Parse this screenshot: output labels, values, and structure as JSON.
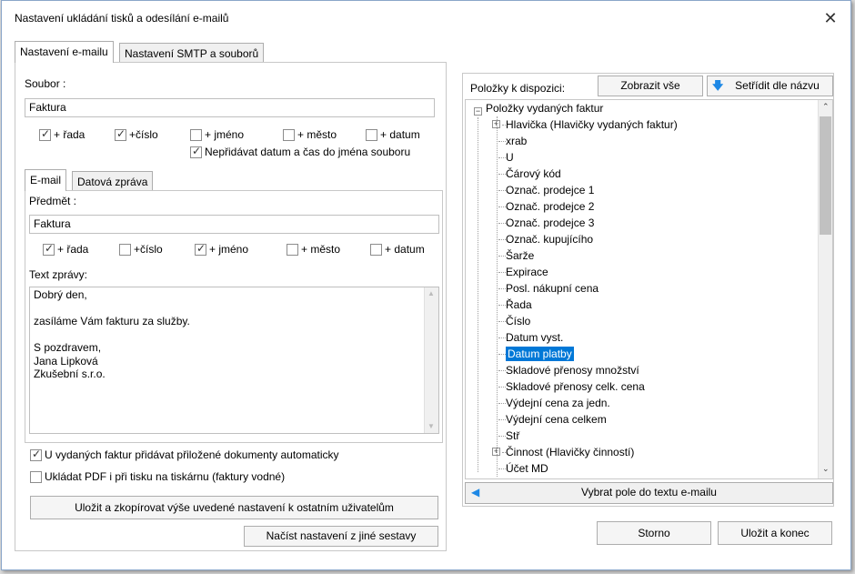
{
  "window": {
    "title": "Nastavení ukládání tisků a odesílání e-mailů",
    "close_glyph": "✕"
  },
  "tabs": [
    {
      "label": "Nastavení e-mailu",
      "active": true
    },
    {
      "label": "Nastavení SMTP a souborů",
      "active": false
    }
  ],
  "soubor": {
    "label": "Soubor :",
    "value": "Faktura",
    "checks": [
      {
        "label": "+ řada",
        "checked": true
      },
      {
        "label": "+číslo",
        "checked": true
      },
      {
        "label": "+ jméno",
        "checked": false
      },
      {
        "label": "+ město",
        "checked": false
      },
      {
        "label": "+ datum",
        "checked": false
      }
    ],
    "no_datetime": {
      "label": "Nepřidávat datum a čas do jména souboru",
      "checked": true
    }
  },
  "subtabs": [
    {
      "label": "E-mail",
      "active": true
    },
    {
      "label": "Datová zpráva",
      "active": false
    }
  ],
  "email": {
    "subject_label": "Předmět :",
    "subject_value": "Faktura",
    "checks": [
      {
        "label": "+ řada",
        "checked": true
      },
      {
        "label": "+číslo",
        "checked": false
      },
      {
        "label": "+ jméno",
        "checked": true
      },
      {
        "label": "+ město",
        "checked": false
      },
      {
        "label": "+ datum",
        "checked": false
      }
    ],
    "body_label": "Text zprávy:",
    "body_lines": [
      "Dobrý den,",
      "",
      "zasíláme Vám fakturu za služby.",
      "",
      "S pozdravem,",
      "Jana Lipková",
      "Zkušební s.r.o."
    ]
  },
  "options": {
    "attach_docs": {
      "label": "U vydaných faktur přidávat přiložené dokumenty automaticky",
      "checked": true
    },
    "pdf_print": {
      "label": "Ukládat PDF i při tisku na tiskárnu (faktury vodné)",
      "checked": false
    }
  },
  "buttons": {
    "copy_settings": "Uložit a zkopírovat výše uvedené nastavení k ostatním uživatelům",
    "load_settings": "Načíst nastavení z jiné sestavy",
    "show_all": "Zobrazit vše",
    "sort_by_name": "Setřídit dle názvu",
    "select_field": "Vybrat pole do textu e-mailu",
    "cancel": "Storno",
    "save_close": "Uložit a konec"
  },
  "available": {
    "label": "Položky k dispozici:",
    "root": "Položky vydaných faktur",
    "items": [
      {
        "label": "Hlavička (Hlavičky vydaných faktur)",
        "expandable": true,
        "selected": false
      },
      {
        "label": "xrab",
        "expandable": false,
        "selected": false
      },
      {
        "label": "U",
        "expandable": false,
        "selected": false
      },
      {
        "label": "Čárový kód",
        "expandable": false,
        "selected": false
      },
      {
        "label": "Označ. prodejce 1",
        "expandable": false,
        "selected": false
      },
      {
        "label": "Označ. prodejce 2",
        "expandable": false,
        "selected": false
      },
      {
        "label": "Označ. prodejce 3",
        "expandable": false,
        "selected": false
      },
      {
        "label": "Označ. kupujícího",
        "expandable": false,
        "selected": false
      },
      {
        "label": "Šarže",
        "expandable": false,
        "selected": false
      },
      {
        "label": "Expirace",
        "expandable": false,
        "selected": false
      },
      {
        "label": "Posl. nákupní cena",
        "expandable": false,
        "selected": false
      },
      {
        "label": "Řada",
        "expandable": false,
        "selected": false
      },
      {
        "label": "Číslo",
        "expandable": false,
        "selected": false
      },
      {
        "label": "Datum vyst.",
        "expandable": false,
        "selected": false
      },
      {
        "label": "Datum platby",
        "expandable": false,
        "selected": true
      },
      {
        "label": "Skladové přenosy množství",
        "expandable": false,
        "selected": false
      },
      {
        "label": "Skladové přenosy celk. cena",
        "expandable": false,
        "selected": false
      },
      {
        "label": "Výdejní cena za jedn.",
        "expandable": false,
        "selected": false
      },
      {
        "label": "Výdejní cena celkem",
        "expandable": false,
        "selected": false
      },
      {
        "label": "Stř",
        "expandable": false,
        "selected": false
      },
      {
        "label": "Činnost (Hlavičky činností)",
        "expandable": true,
        "selected": false
      },
      {
        "label": "Účet MD",
        "expandable": false,
        "selected": false
      }
    ]
  }
}
